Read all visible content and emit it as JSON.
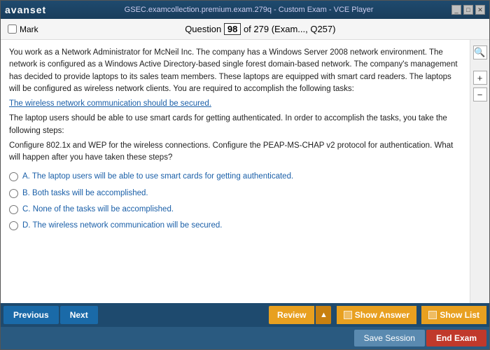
{
  "titleBar": {
    "logo": "avan",
    "logoSpan": "set",
    "title": "GSEC.examcollection.premium.exam.279q - Custom Exam - VCE Player",
    "controls": [
      "minimize",
      "maximize",
      "close"
    ]
  },
  "questionHeader": {
    "markLabel": "Mark",
    "questionLabel": "Question",
    "questionNum": "98",
    "ofText": "of 279 (Exam..., Q257)"
  },
  "questionBody": {
    "paragraph1": "You work as a Network Administrator for McNeil Inc. The company has a Windows Server 2008 network environment. The network is configured as a Windows Active Directory-based single forest domain-based network. The company's management has decided to provide laptops to its sales team members. These laptops are equipped with smart card readers. The laptops will be configured as wireless network clients. You are required to accomplish the following tasks:",
    "line1": "The wireless network communication should be secured.",
    "paragraph2": "The laptop users should be able to use smart cards for getting authenticated. In order to accomplish the tasks, you take the following steps:",
    "line2": "Configure 802.1x and WEP for the wireless connections. Configure the PEAP-MS-CHAP v2 protocol for authentication. What will happen after you have taken these steps?",
    "answers": [
      {
        "id": "A",
        "text": "A.  The laptop users will be able to use smart cards for getting authenticated."
      },
      {
        "id": "B",
        "text": "B.  Both tasks will be accomplished."
      },
      {
        "id": "C",
        "text": "C.  None of the tasks will be accomplished."
      },
      {
        "id": "D",
        "text": "D.  The wireless network communication will be secured."
      }
    ]
  },
  "toolbar1": {
    "prevLabel": "Previous",
    "nextLabel": "Next",
    "reviewLabel": "Review",
    "showAnswerLabel": "Show Answer",
    "showListLabel": "Show List"
  },
  "toolbar2": {
    "saveSessionLabel": "Save Session",
    "endExamLabel": "End Exam"
  },
  "sideTools": {
    "searchSymbol": "🔍",
    "zoomInSymbol": "+",
    "zoomOutSymbol": "−"
  }
}
